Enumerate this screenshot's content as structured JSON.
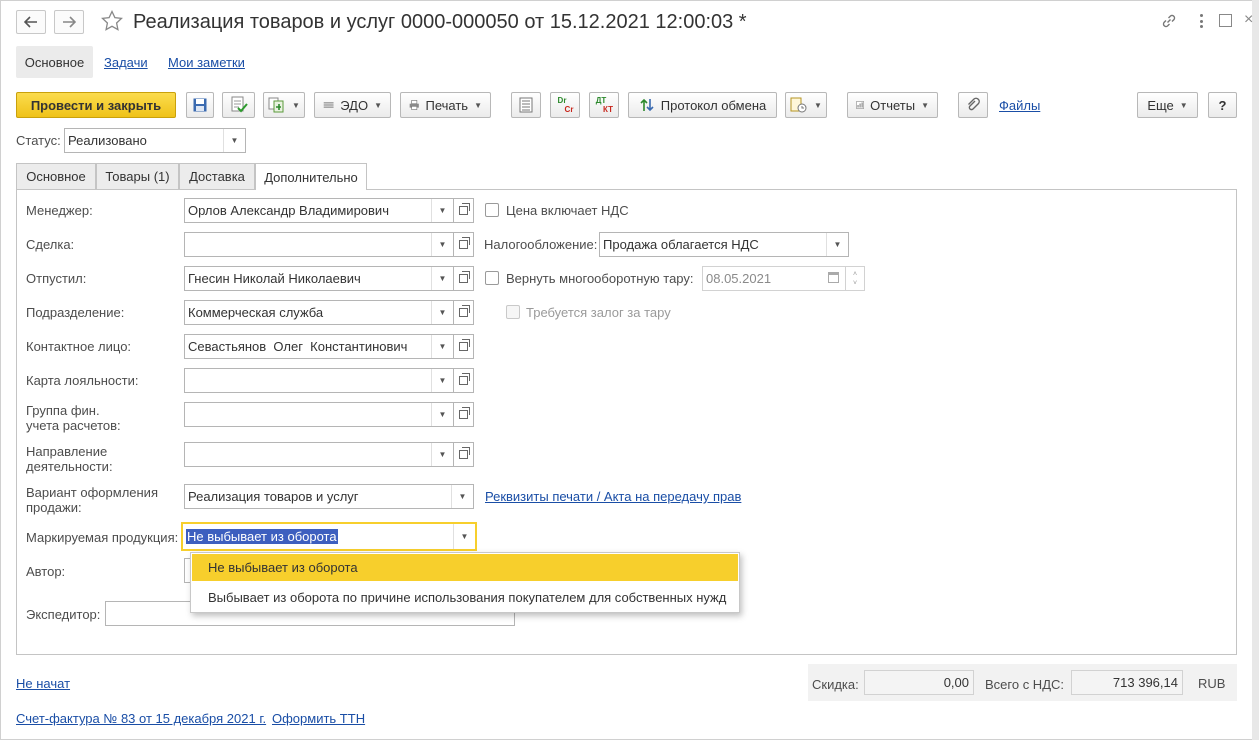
{
  "window": {
    "title": "Реализация товаров и услуг 0000-000050 от 15.12.2021 12:00:03 *"
  },
  "nav_tabs": [
    {
      "label": "Основное"
    },
    {
      "label": "Задачи"
    },
    {
      "label": "Мои заметки"
    }
  ],
  "toolbar": {
    "post_close": "Провести и закрыть",
    "edo": "ЭДО",
    "print": "Печать",
    "dr_cr_top": "Dr",
    "dr_cr_bot": "Cr",
    "dt_kt_top": "ДТ",
    "dt_kt_bot": "КТ",
    "exchange_log": "Протокол обмена",
    "reports": "Отчеты",
    "files": "Файлы",
    "more": "Еще",
    "help": "?"
  },
  "status": {
    "label": "Статус:",
    "value": "Реализовано"
  },
  "form_tabs": [
    {
      "label": "Основное"
    },
    {
      "label": "Товары (1)"
    },
    {
      "label": "Доставка"
    },
    {
      "label": "Дополнительно"
    }
  ],
  "fields": {
    "manager": {
      "label": "Менеджер:",
      "value": "Орлов Александр Владимирович"
    },
    "deal": {
      "label": "Сделка:",
      "value": ""
    },
    "released": {
      "label": "Отпустил:",
      "value": "Гнесин Николай Николаевич"
    },
    "department": {
      "label": "Подразделение:",
      "value": "Коммерческая служба"
    },
    "contact": {
      "label": "Контактное лицо:",
      "value": "Севастьянов  Олег  Константинович"
    },
    "loyalty": {
      "label": "Карта лояльности:",
      "value": ""
    },
    "fin_group_l1": "Группа фин.",
    "fin_group_l2": "учета расчетов:",
    "fin_group_value": "",
    "direction_l1": "Направление",
    "direction_l2": "деятельности:",
    "direction_value": "",
    "sale_variant_l1": "Вариант оформления",
    "sale_variant_l2": "продажи:",
    "sale_variant_value": "Реализация товаров и услуг",
    "marked": {
      "label": "Маркируемая продукция:",
      "value": "Не выбывает из оборота"
    },
    "author": {
      "label": "Автор:",
      "value": ""
    },
    "forwarder": {
      "label": "Экспедитор:",
      "value": ""
    }
  },
  "right": {
    "price_incl_vat": "Цена включает НДС",
    "taxation_label": "Налогообложение:",
    "taxation_value": "Продажа облагается НДС",
    "return_tare": "Вернуть многооборотную тару:",
    "return_date": "08.05.2021",
    "deposit_required": "Требуется залог за тару",
    "print_details_link": "Реквизиты печати / Акта на передачу прав"
  },
  "dropdown": {
    "options": [
      "Не выбывает из оборота",
      "Выбывает из оборота по причине использования покупателем для собственных нужд"
    ]
  },
  "footer": {
    "state_link": "Не начат",
    "discount_label": "Скидка:",
    "discount_value": "0,00",
    "total_label": "Всего с НДС:",
    "total_value": "713 396,14",
    "currency": "RUB",
    "invoice_link": "Счет-фактура № 83 от 15 декабря 2021 г.",
    "ttn_link": "Оформить ТТН"
  },
  "colors": {
    "accent_yellow": "#f7cf2c",
    "link_blue": "#1a4ea6",
    "selection_blue": "#3d5fbf"
  }
}
